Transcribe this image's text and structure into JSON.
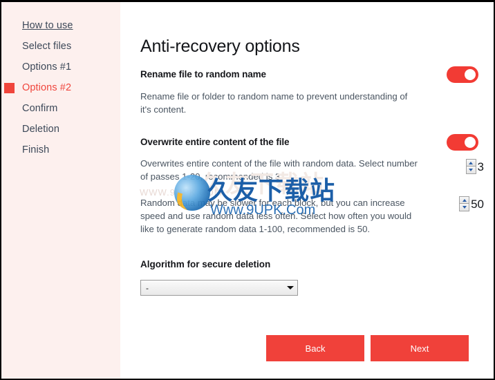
{
  "window": {
    "controls": {
      "more_label": "•••",
      "more_name": "more-options",
      "minimize_name": "minimize",
      "close_name": "close"
    }
  },
  "sidebar": {
    "items": [
      {
        "label": "How to use",
        "active": false,
        "link": true
      },
      {
        "label": "Select files",
        "active": false,
        "link": false
      },
      {
        "label": "Options #1",
        "active": false,
        "link": false
      },
      {
        "label": "Options #2",
        "active": true,
        "link": false
      },
      {
        "label": "Confirm",
        "active": false,
        "link": false
      },
      {
        "label": "Deletion",
        "active": false,
        "link": false
      },
      {
        "label": "Finish",
        "active": false,
        "link": false
      }
    ]
  },
  "main": {
    "title": "Anti-recovery options",
    "options": [
      {
        "heading": "Rename file to random name",
        "description": "Rename file or folder to random name to prevent understanding of it's content.",
        "toggle_on": true
      },
      {
        "heading": "Overwrite entire content of the file",
        "description": "Overwrites entire content of the file with random data. Select number of passes 1-20, recommended is 3.",
        "toggle_on": true
      }
    ],
    "frequency_description": "Random data may be slower for each block, but you can increase speed and use random data less often. Select how often you would like to generate random data 1-100, recommended is 50.",
    "spinners": [
      {
        "name": "passes",
        "value": "3"
      },
      {
        "name": "frequency",
        "value": "50"
      }
    ],
    "algorithm": {
      "label": "Algorithm for secure deletion",
      "selected": "-"
    },
    "buttons": {
      "back": "Back",
      "next": "Next"
    }
  },
  "watermark": {
    "faint_text": "久友下载站",
    "left_text": "WWW.9UPK.COM",
    "chinese": "久友下载站",
    "url": "Www.9UPK.Com"
  },
  "colors": {
    "accent_red": "#f0413a",
    "sidebar_bg": "#fdf0ee",
    "watermark_blue": "#1c5fa8"
  }
}
